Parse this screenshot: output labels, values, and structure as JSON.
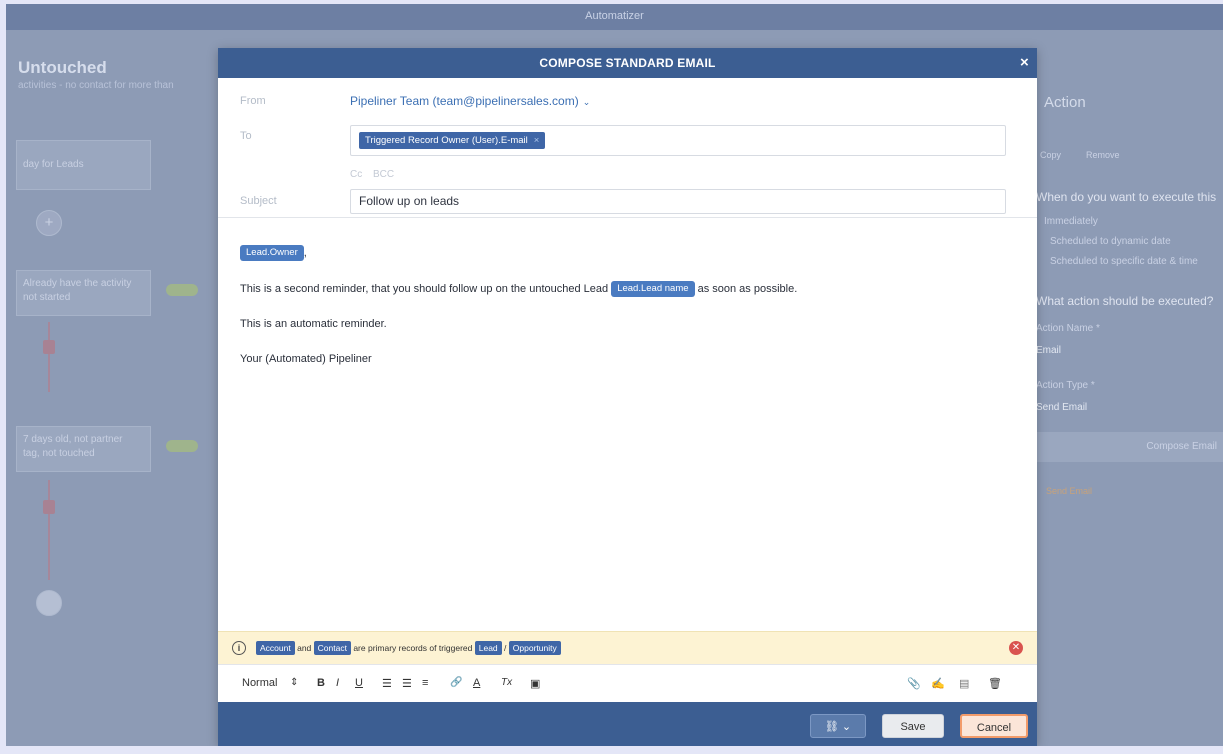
{
  "app": {
    "title": "Automatizer"
  },
  "background": {
    "page_title": "Untouched",
    "page_subtitle": "activities - no contact for more than",
    "box1": "day for Leads",
    "box2_line1": "Already have the activity",
    "box2_line2": "not started",
    "box3_line1": "7 days old, not partner",
    "box3_line2": "tag, not touched",
    "right_action": "Action",
    "right_copy": "Copy",
    "right_remove": "Remove",
    "right_when": "When do you want to execute this",
    "right_opt1": "Immediately",
    "right_opt2": "Scheduled to dynamic date",
    "right_opt3": "Scheduled to specific date & time",
    "right_what": "What action should be executed?",
    "right_action_name_label": "Action Name *",
    "right_action_name_val": "Email",
    "right_action_type_label": "Action Type *",
    "right_action_type_val": "Send Email",
    "right_compose": "Compose Email",
    "right_warning": "Send Email"
  },
  "modal": {
    "title": "COMPOSE STANDARD EMAIL",
    "close": "×",
    "from_label": "From",
    "from_value": "Pipeliner Team (team@pipelinersales.com)",
    "to_label": "To",
    "to_chip": "Triggered Record Owner (User).E-mail",
    "to_chip_remove": "×",
    "cc": "Cc",
    "bcc": "BCC",
    "subject_label": "Subject",
    "subject_value": "Follow up on leads"
  },
  "body": {
    "greeting_chip": "Lead.Owner",
    "greeting_punct": ",",
    "line1_a": "This is a second reminder, that you should follow up on the untouched Lead",
    "line1_chip": "Lead.Lead name",
    "line1_b": "as soon as possible.",
    "line2": "This is an automatic reminder.",
    "line3": "Your (Automated) Pipeliner"
  },
  "info": {
    "icon": "i",
    "chip_account": "Account",
    "and": "and",
    "chip_contact": "Contact",
    "text": "are primary records of triggered",
    "chip_lead": "Lead",
    "slash": "/",
    "chip_opportunity": "Opportunity",
    "close": "✕"
  },
  "toolbar": {
    "format": "Normal",
    "format_arrows": "⇕",
    "bold": "B",
    "italic": "I",
    "underline": "U",
    "ol": "☰",
    "ul": "☰",
    "align": "≡",
    "link": "🔗",
    "color": "A",
    "clear": "Tx",
    "image": "▣",
    "attach": "📎",
    "signature": "✍",
    "template": "▤",
    "delete": "🗑"
  },
  "footer": {
    "link_chevron": "⌄",
    "save": "Save",
    "cancel": "Cancel"
  }
}
